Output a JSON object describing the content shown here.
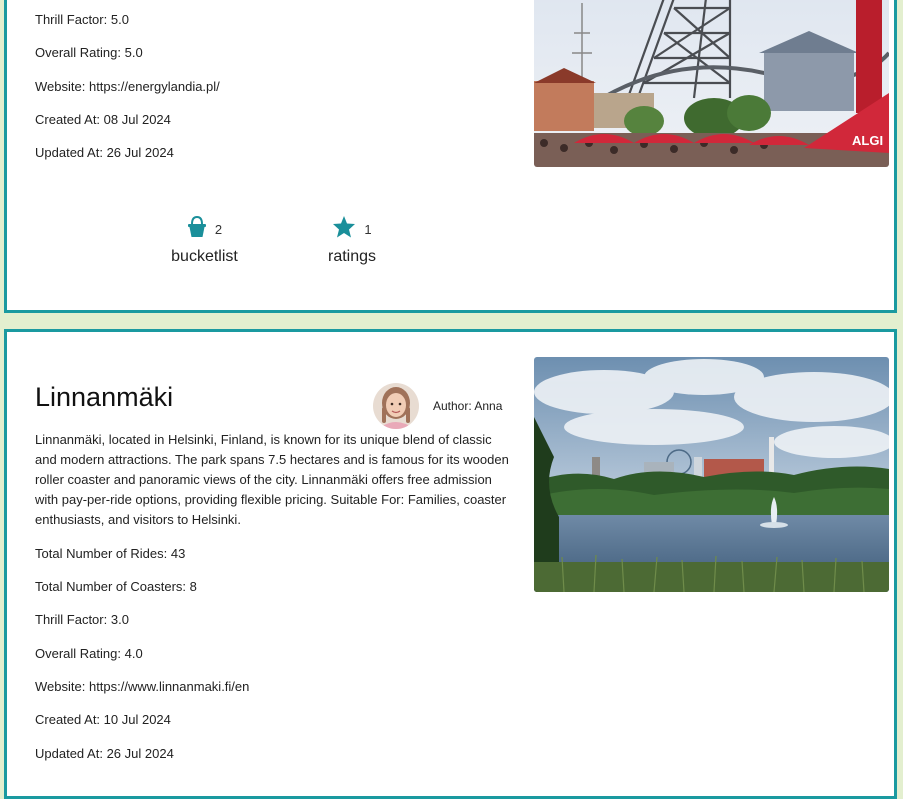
{
  "colors": {
    "accent": "#1a9aa0",
    "page_background": "#e3efcf"
  },
  "card1": {
    "fields": {
      "thrill": {
        "label": "Thrill Factor:",
        "value": "5.0"
      },
      "rating": {
        "label": "Overall Rating:",
        "value": "5.0"
      },
      "website": {
        "label": "Website:",
        "value": "https://energylandia.pl/"
      },
      "created": {
        "label": "Created At:",
        "value": "08 Jul 2024"
      },
      "updated": {
        "label": "Updated At:",
        "value": "26 Jul 2024"
      }
    },
    "bucketlist": {
      "icon": "bucket-icon",
      "count": "2",
      "label": "bucketlist"
    },
    "ratings": {
      "icon": "star-icon",
      "count": "1",
      "label": "ratings"
    }
  },
  "card2": {
    "title": "Linnanmäki",
    "author": "Author: Anna",
    "description": "Linnanmäki, located in Helsinki, Finland, is known for its unique blend of classic and modern attractions. The park spans 7.5 hectares and is famous for its wooden roller coaster and panoramic views of the city. Linnanmäki offers free admission with pay-per-ride options, providing flexible pricing. Suitable For: Families, coaster enthusiasts, and visitors to Helsinki.",
    "fields": {
      "rides": {
        "label": "Total Number of Rides:",
        "value": "43"
      },
      "coasters": {
        "label": "Total Number of Coasters:",
        "value": "8"
      },
      "thrill": {
        "label": "Thrill Factor:",
        "value": "3.0"
      },
      "rating": {
        "label": "Overall Rating:",
        "value": "4.0"
      },
      "website": {
        "label": "Website:",
        "value": "https://www.linnanmaki.fi/en"
      },
      "created": {
        "label": "Created At:",
        "value": "10 Jul 2024"
      },
      "updated": {
        "label": "Updated At:",
        "value": "26 Jul 2024"
      }
    }
  }
}
